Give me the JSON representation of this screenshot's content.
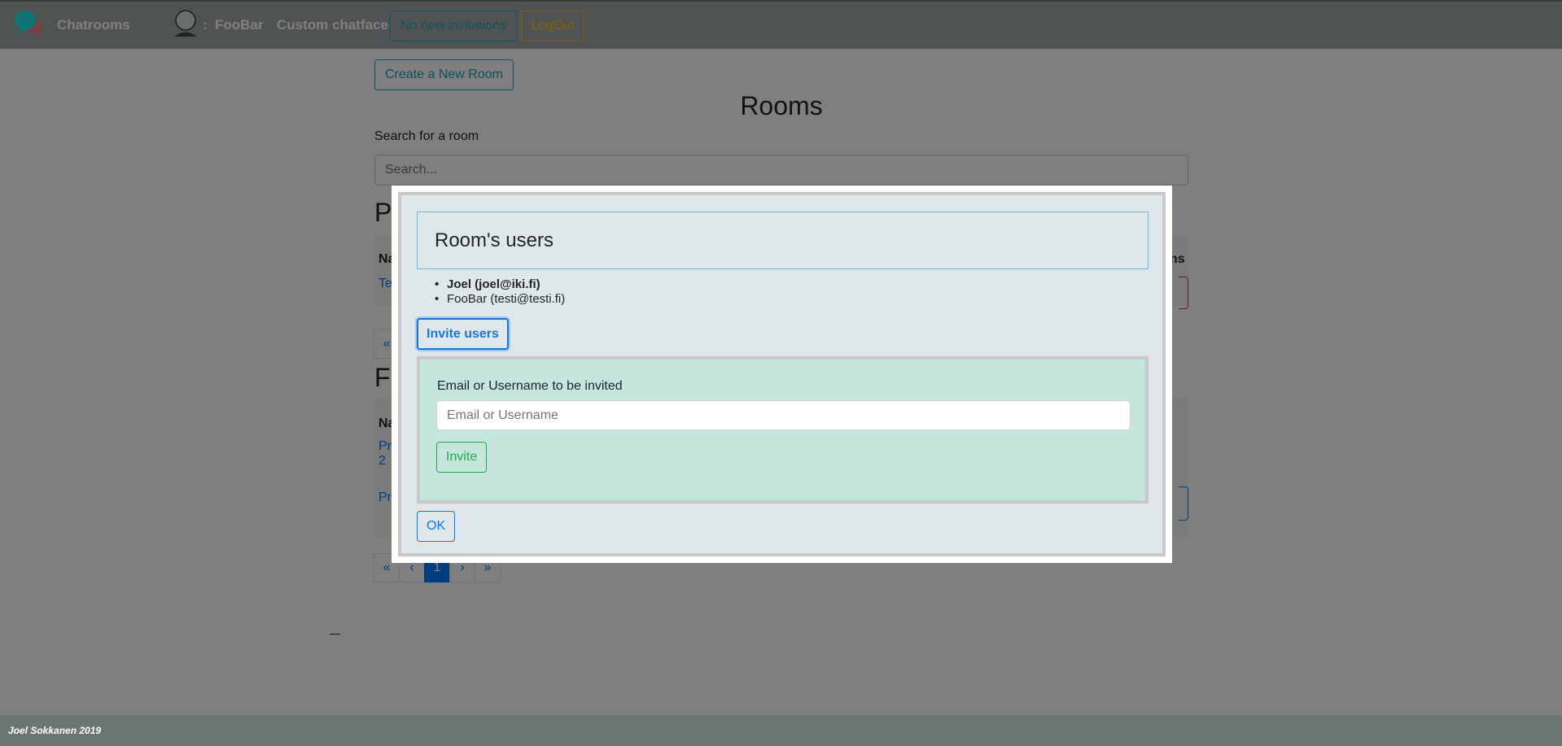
{
  "navbar": {
    "brand": "Chatrooms",
    "brand_icon": "chat-bubbles-icon",
    "user_icon": "user-avatar-icon",
    "user_separator": ":",
    "username": "FooBar",
    "custom_chatface": "Custom chatface",
    "invitations_button": "No new invitations",
    "logout_button": "LogOut"
  },
  "main": {
    "create_room_button": "Create a New Room",
    "title": "Rooms",
    "search_label": "Search for a room",
    "search_placeholder": "Search...",
    "section_public_fragment": "P",
    "section_friends_fragment": "F",
    "table1": {
      "header_fragment": "Na",
      "header_right_fragment": "ns",
      "row_fragment": "Te"
    },
    "table2": {
      "header_fragment": "Na",
      "row1_fragment_a": "Pr",
      "row1_fragment_b": "2",
      "row2_fragment": "Pr"
    },
    "pager1": [
      "«"
    ],
    "pager2": [
      "«",
      "‹",
      "1",
      "›",
      "»"
    ],
    "pager2_active": "1",
    "dash": "—"
  },
  "modal": {
    "title": "Room's users",
    "users": [
      {
        "label": "Joel (joel@iki.fi)",
        "bold": true
      },
      {
        "label": "FooBar (testi@testi.fi)",
        "bold": false
      }
    ],
    "invite_users_button": "Invite users",
    "invite_label": "Email or Username to be invited",
    "invite_placeholder": "Email or Username",
    "invite_button": "Invite",
    "ok_button": "OK"
  },
  "footer": {
    "text": "Joel Sokkanen 2019"
  },
  "colors": {
    "navbar": "#9ea7a6",
    "footer": "#6c7574",
    "invitations": "#2aa6b6",
    "logout": "#ffc107",
    "modal_bg": "#e0e7ea",
    "invite_panel": "#c5e6dc",
    "primary": "#007bff",
    "success": "#28a745"
  }
}
